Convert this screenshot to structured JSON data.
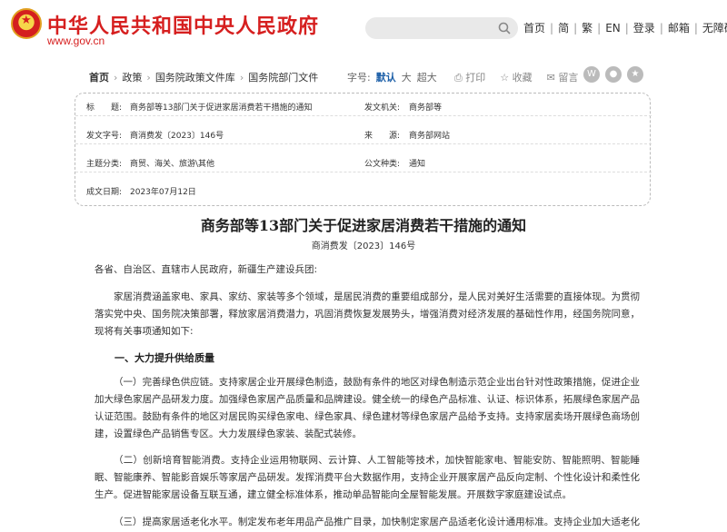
{
  "header": {
    "site_title": "中华人民共和国中央人民政府",
    "site_domain": "www.gov.cn",
    "search_placeholder": "",
    "nav": [
      "首页",
      "简",
      "繁",
      "EN",
      "登录",
      "邮箱",
      "无障碍"
    ]
  },
  "breadcrumb": [
    "首页",
    "政策",
    "国务院政策文件库",
    "国务院部门文件"
  ],
  "toolbar": {
    "font_label": "字号:",
    "font_sizes": [
      "默认",
      "大",
      "超大"
    ],
    "print": "打印",
    "favorite": "收藏",
    "comment": "留言",
    "share_icons": [
      "weibo-icon",
      "wechat-icon",
      "more-icon"
    ]
  },
  "meta": {
    "rows": [
      {
        "k1": "标　　题:",
        "v1": "商务部等13部门关于促进家居消费若干措施的通知",
        "k2": "发文机关:",
        "v2": "商务部等"
      },
      {
        "k1": "发文字号:",
        "v1": "商消费发〔2023〕146号",
        "k2": "来　　源:",
        "v2": "商务部网站"
      },
      {
        "k1": "主题分类:",
        "v1": "商贸、海关、旅游\\其他",
        "k2": "公文种类:",
        "v2": "通知"
      },
      {
        "k1": "成文日期:",
        "v1": "2023年07月12日",
        "k2": "",
        "v2": ""
      }
    ]
  },
  "article": {
    "title": "商务部等13部门关于促进家居消费若干措施的通知",
    "doc_number": "商消费发〔2023〕146号",
    "salutation": "各省、自治区、直辖市人民政府，新疆生产建设兵团:",
    "intro": "家居消费涵盖家电、家具、家纺、家装等多个领域，是居民消费的重要组成部分，是人民对美好生活需要的直接体现。为贯彻落实党中央、国务院决策部署，释放家居消费潜力，巩固消费恢复发展势头，增强消费对经济发展的基础性作用，经国务院同意，现将有关事项通知如下:",
    "section1": "一、大力提升供给质量",
    "p1": "（一）完善绿色供应链。支持家居企业开展绿色制造，鼓励有条件的地区对绿色制造示范企业出台针对性政策措施，促进企业加大绿色家居产品研发力度。加强绿色家居产品质量和品牌建设。健全统一的绿色产品标准、认证、标识体系，拓展绿色家居产品认证范围。鼓励有条件的地区对居民购买绿色家电、绿色家具、绿色建材等绿色家居产品给予支持。支持家居卖场开展绿色商场创建，设置绿色产品销售专区。大力发展绿色家装、装配式装修。",
    "p2": "（二）创新培育智能消费。支持企业运用物联网、云计算、人工智能等技术，加快智能家电、智能安防、智能照明、智能睡眠、智能康养、智能影音娱乐等家居产品研发。发挥消费平台大数据作用，支持企业开展家居产品反向定制、个性化设计和柔性化生产。促进智能家居设备互联互通，建立健全标准体系，推动单品智能向全屋智能发展。开展数字家庭建设试点。",
    "p3": "（三）提高家居适老化水平。制定发布老年用品产品推广目录，加快制定家居产品适老化设计通用标准。支持企业加大适老化家"
  }
}
